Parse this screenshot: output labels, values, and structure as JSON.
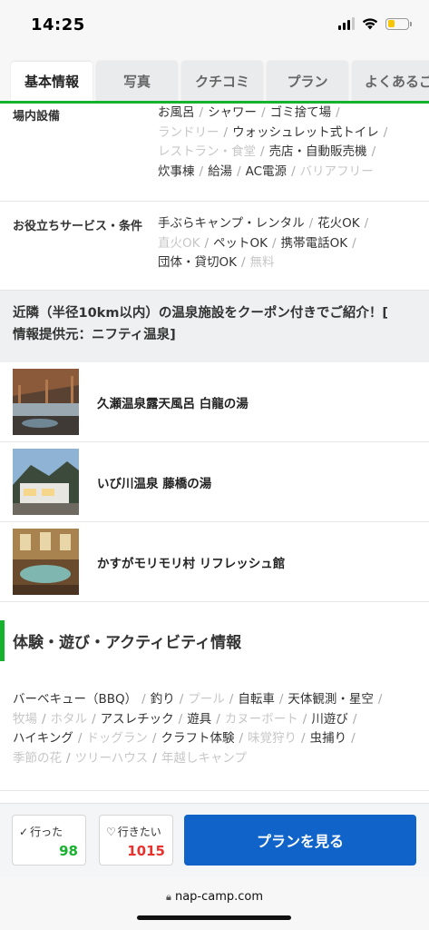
{
  "status": {
    "time": "14:25"
  },
  "tabs": [
    {
      "label": "基本情報",
      "active": true
    },
    {
      "label": "写真"
    },
    {
      "label": "クチコミ"
    },
    {
      "label": "プラン"
    },
    {
      "label": "よくあるご"
    }
  ],
  "facilities": {
    "label": "場内設備",
    "lines": [
      [
        {
          "text": "お風呂"
        },
        {
          "text": "シャワー"
        },
        {
          "text": "ゴミ捨て場"
        }
      ],
      [
        {
          "text": "ランドリー",
          "off": true
        },
        {
          "text": "ウォッシュレット式トイレ"
        }
      ],
      [
        {
          "text": "レストラン・食堂",
          "off": true
        },
        {
          "text": "売店・自動販売機"
        }
      ],
      [
        {
          "text": "炊事棟"
        },
        {
          "text": "給湯"
        },
        {
          "text": "AC電源"
        },
        {
          "text": "バリアフリー",
          "off": true
        }
      ]
    ]
  },
  "services": {
    "label": "お役立ちサービス・条件",
    "lines": [
      [
        {
          "text": "手ぶらキャンプ・レンタル"
        },
        {
          "text": "花火OK"
        }
      ],
      [
        {
          "text": "直火OK",
          "off": true
        },
        {
          "text": "ペットOK"
        },
        {
          "text": "携帯電話OK"
        }
      ],
      [
        {
          "text": "団体・貸切OK"
        },
        {
          "text": "無料",
          "off": true
        }
      ]
    ]
  },
  "onsen": {
    "header_line1": "近隣（半径10km以内）の温泉施設をクーポン付きでご紹介！[",
    "header_line2": "情報提供元：ニフティ温泉]",
    "items": [
      {
        "name": "久瀬温泉露天風呂 白龍の湯"
      },
      {
        "name": "いび川温泉 藤橋の湯"
      },
      {
        "name": "かすがモリモリ村 リフレッシュ館"
      }
    ]
  },
  "activities": {
    "title": "体験・遊び・アクティビティ情報",
    "lines": [
      [
        {
          "text": "バーベキュー（BBQ）"
        },
        {
          "text": "釣り"
        },
        {
          "text": "プール",
          "off": true
        },
        {
          "text": "自転車"
        },
        {
          "text": "天体観測・星空"
        }
      ],
      [
        {
          "text": "牧場",
          "off": true
        },
        {
          "text": "ホタル",
          "off": true
        },
        {
          "text": "アスレチック"
        },
        {
          "text": "遊具"
        },
        {
          "text": "カヌーボート",
          "off": true
        },
        {
          "text": "川遊び"
        }
      ],
      [
        {
          "text": "ハイキング"
        },
        {
          "text": "ドッグラン",
          "off": true
        },
        {
          "text": "クラフト体験"
        },
        {
          "text": "味覚狩り",
          "off": true
        },
        {
          "text": "虫捕り"
        }
      ],
      [
        {
          "text": "季節の花",
          "off": true
        },
        {
          "text": "ツリーハウス",
          "off": true
        },
        {
          "text": "年越しキャンプ",
          "off": true
        }
      ]
    ]
  },
  "bottom": {
    "went_label": "行った",
    "went_count": "98",
    "want_label": "行きたい",
    "want_count": "1015",
    "cta_label": "プランを見る"
  },
  "browser": {
    "url": "nap-camp.com"
  },
  "colors": {
    "brand_green": "#16b22e",
    "cta_blue": "#0f63c9",
    "want_red": "#e8322d",
    "disabled_text": "#c7c7c7"
  }
}
